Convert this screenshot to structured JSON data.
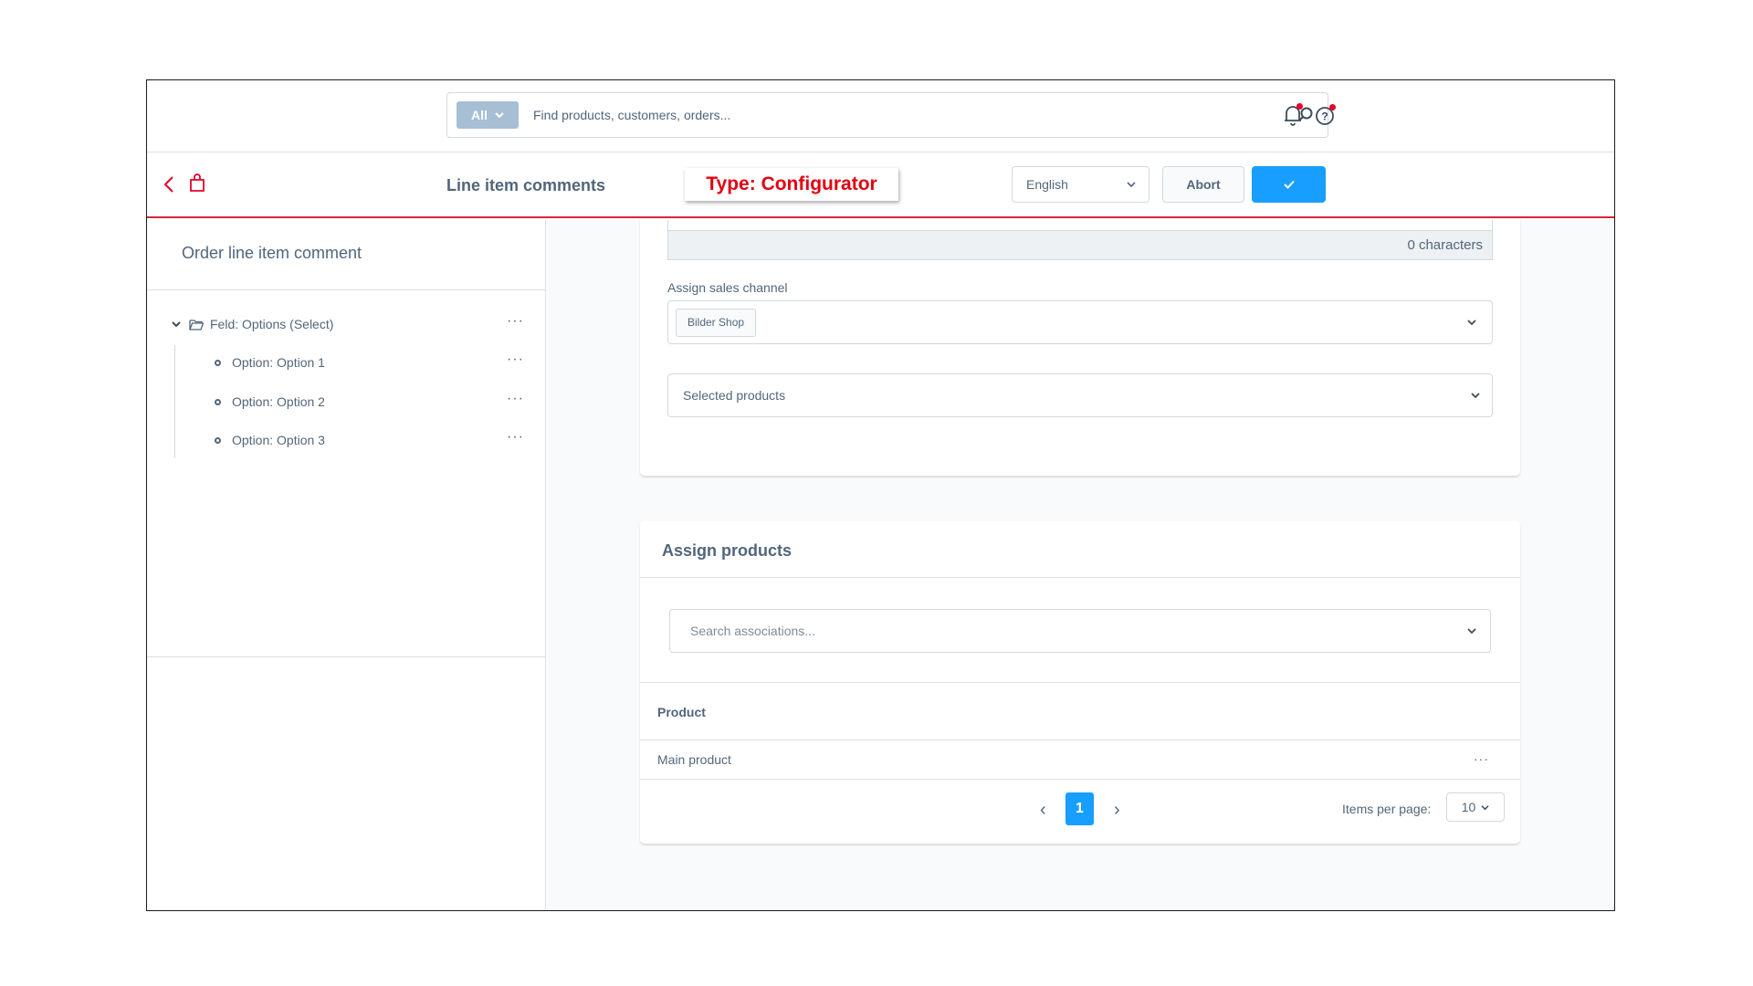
{
  "header": {
    "search_type": "All",
    "search_placeholder": "Find products, customers, orders..."
  },
  "smartbar": {
    "title": "Line item comments",
    "type_label": "Type: Configurator",
    "language": "English",
    "abort_label": "Abort"
  },
  "sidebar": {
    "title": "Order line item comment",
    "tree": {
      "root_label": "Feld: Options (Select)",
      "children": [
        {
          "label": "Option: Option 1"
        },
        {
          "label": "Option: Option 2"
        },
        {
          "label": "Option: Option 3"
        }
      ]
    }
  },
  "main": {
    "char_count": "0 characters",
    "sales_channel_label": "Assign sales channel",
    "sales_channel_tag": "Bilder Shop",
    "selected_products_label": "Selected products",
    "assign_products": {
      "title": "Assign products",
      "search_placeholder": "Search associations...",
      "column_header": "Product",
      "rows": [
        {
          "name": "Main product"
        }
      ],
      "pagination": {
        "current_page": "1",
        "items_per_page_label": "Items per page:",
        "items_per_page_value": "10"
      }
    }
  },
  "colors": {
    "accent": "#189eff",
    "smartbar_border": "#d7263d",
    "type_label": "#e3000f",
    "notification_dot": "#e3002c"
  }
}
